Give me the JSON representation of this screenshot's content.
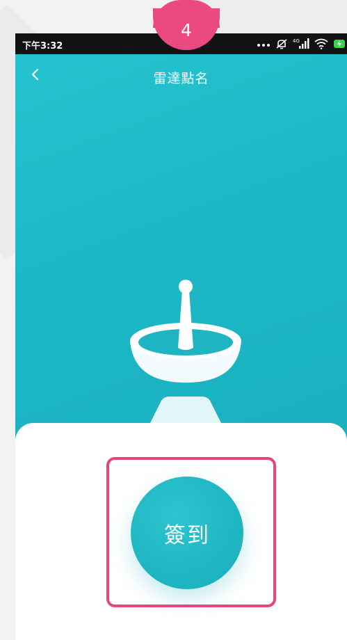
{
  "status_bar": {
    "time": "下午3:32",
    "icons": [
      "more-dots-icon",
      "mute-icon",
      "signal-4g-icon",
      "wifi-icon",
      "battery-charging-icon"
    ],
    "network_label": "4G"
  },
  "nav": {
    "back_icon": "chevron-left-icon",
    "title": "雷達點名"
  },
  "main": {
    "checkin_label": "簽到"
  },
  "annotation": {
    "step_number": "4"
  },
  "colors": {
    "teal": "#1db8c6",
    "highlight": "#e8447e",
    "badge": "#ea4a7f"
  }
}
